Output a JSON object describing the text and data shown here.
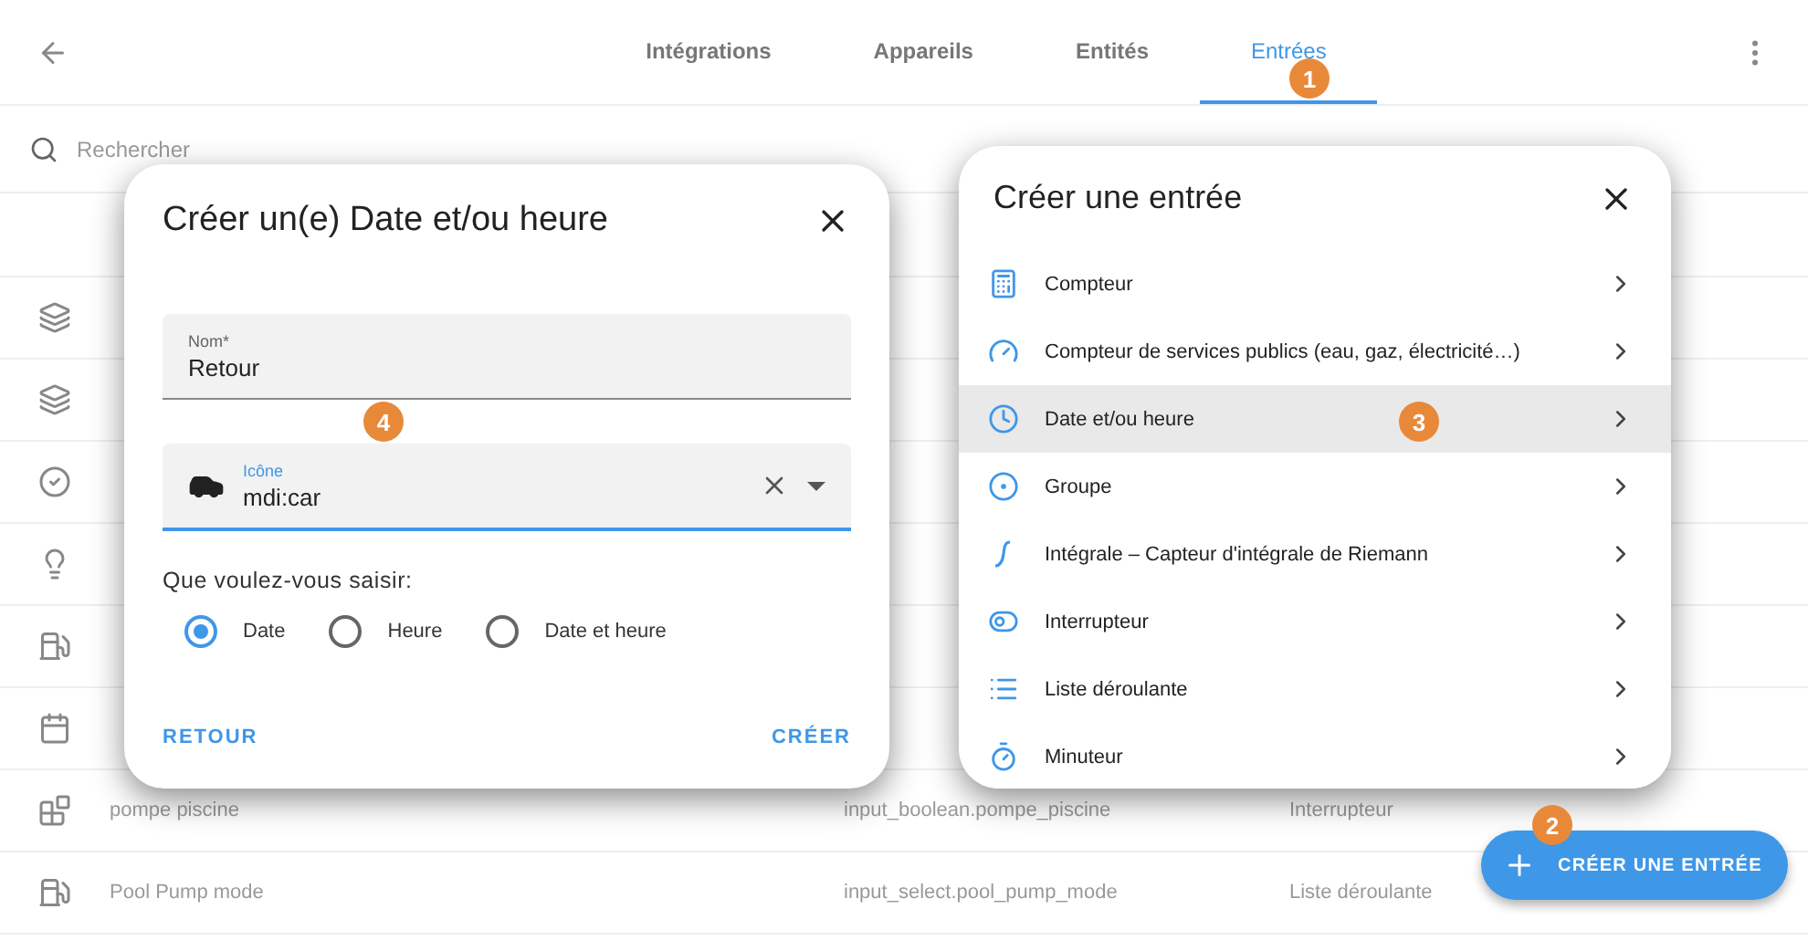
{
  "header": {
    "tabs": [
      {
        "label": "Intégrations",
        "selected": false
      },
      {
        "label": "Appareils",
        "selected": false
      },
      {
        "label": "Entités",
        "selected": false
      },
      {
        "label": "Entrées",
        "selected": true
      }
    ]
  },
  "search": {
    "placeholder": "Rechercher"
  },
  "table": {
    "rows": [
      {
        "name": "pompe piscine",
        "entity_id": "input_boolean.pompe_piscine",
        "type": "Interrupteur"
      },
      {
        "name": "Pool Pump mode",
        "entity_id": "input_select.pool_pump_mode",
        "type": "Liste déroulante"
      }
    ]
  },
  "date_dialog": {
    "title": "Créer un(e) Date et/ou heure",
    "name_field": {
      "label": "Nom*",
      "value": "Retour"
    },
    "icon_field": {
      "label": "Icône",
      "value": "mdi:car"
    },
    "question": "Que voulez-vous saisir:",
    "options": [
      {
        "label": "Date",
        "selected": true
      },
      {
        "label": "Heure",
        "selected": false
      },
      {
        "label": "Date et heure",
        "selected": false
      }
    ],
    "buttons": [
      "RETOUR",
      "CRÉER"
    ]
  },
  "create_dialog": {
    "title": "Créer une entrée",
    "items": [
      {
        "label": "Compteur",
        "selected": false
      },
      {
        "label": "Compteur de services publics (eau, gaz, électricité…)",
        "selected": false
      },
      {
        "label": "Date et/ou heure",
        "selected": true
      },
      {
        "label": "Groupe",
        "selected": false
      },
      {
        "label": "Intégrale – Capteur d'intégrale de Riemann",
        "selected": false
      },
      {
        "label": "Interrupteur",
        "selected": false
      },
      {
        "label": "Liste déroulante",
        "selected": false
      },
      {
        "label": "Minuteur",
        "selected": false
      }
    ]
  },
  "fab": {
    "label": "CRÉER UNE ENTRÉE"
  },
  "callouts": [
    "1",
    "2",
    "3",
    "4"
  ]
}
